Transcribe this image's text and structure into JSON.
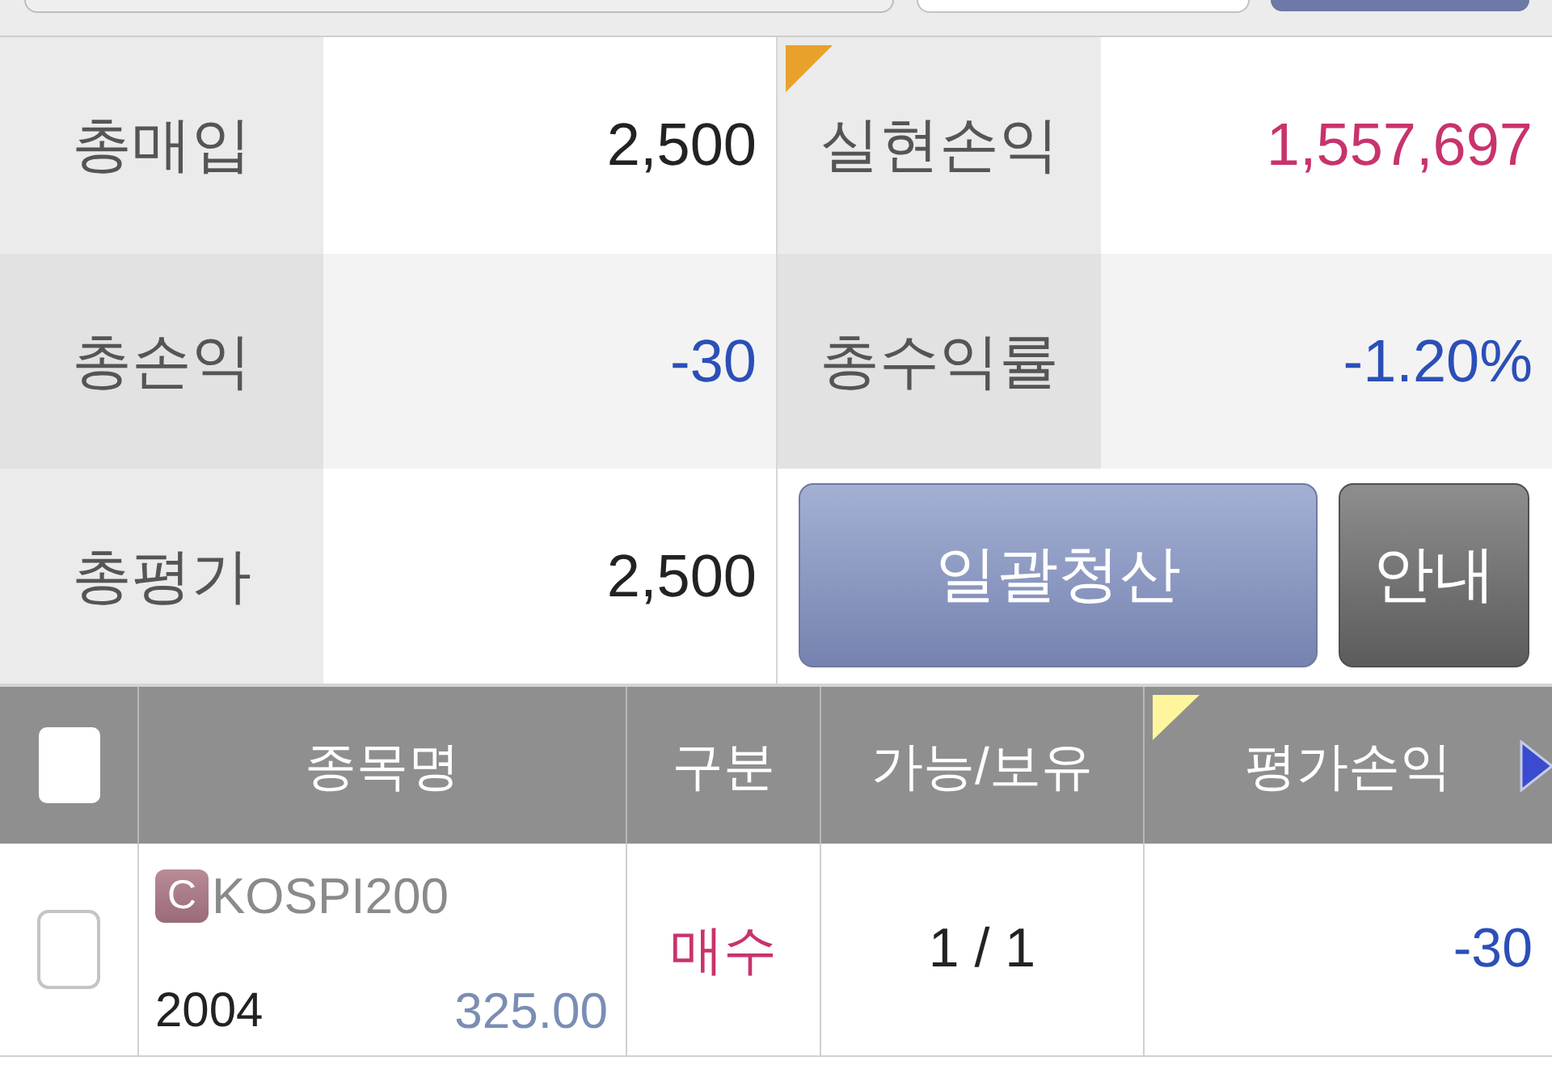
{
  "summary": {
    "rows": [
      {
        "cells": [
          {
            "label": "총매입",
            "value": "2,500",
            "color": "#222222",
            "flagged": false
          },
          {
            "label": "실현손익",
            "value": "1,557,697",
            "color": "#c8336d",
            "flagged": true
          }
        ]
      },
      {
        "cells": [
          {
            "label": "총손익",
            "value": "-30",
            "color": "#2b4fb8",
            "flagged": false
          },
          {
            "label": "총수익률",
            "value": "-1.20%",
            "color": "#2b4fb8",
            "flagged": false
          }
        ]
      },
      {
        "cells": [
          {
            "label": "총평가",
            "value": "2,500",
            "color": "#222222",
            "flagged": false
          }
        ],
        "buttons": [
          {
            "label": "일괄청산",
            "kind": "primary"
          },
          {
            "label": "안내",
            "kind": "secondary"
          }
        ]
      }
    ]
  },
  "table": {
    "select_all_checked": false,
    "columns": [
      {
        "label": "종목명",
        "flagged": false
      },
      {
        "label": "구분",
        "flagged": false
      },
      {
        "label": "가능/보유",
        "flagged": false
      },
      {
        "label": "평가손익",
        "flagged": true
      }
    ],
    "rows": [
      {
        "checked": false,
        "badge": "C",
        "name": "KOSPI200",
        "code": "2004",
        "price": "325.00",
        "side": {
          "label": "매수",
          "color": "#c8336d"
        },
        "quantity": "1 / 1",
        "profit_loss": {
          "value": "-30",
          "color": "#2b4fb8"
        }
      }
    ]
  }
}
